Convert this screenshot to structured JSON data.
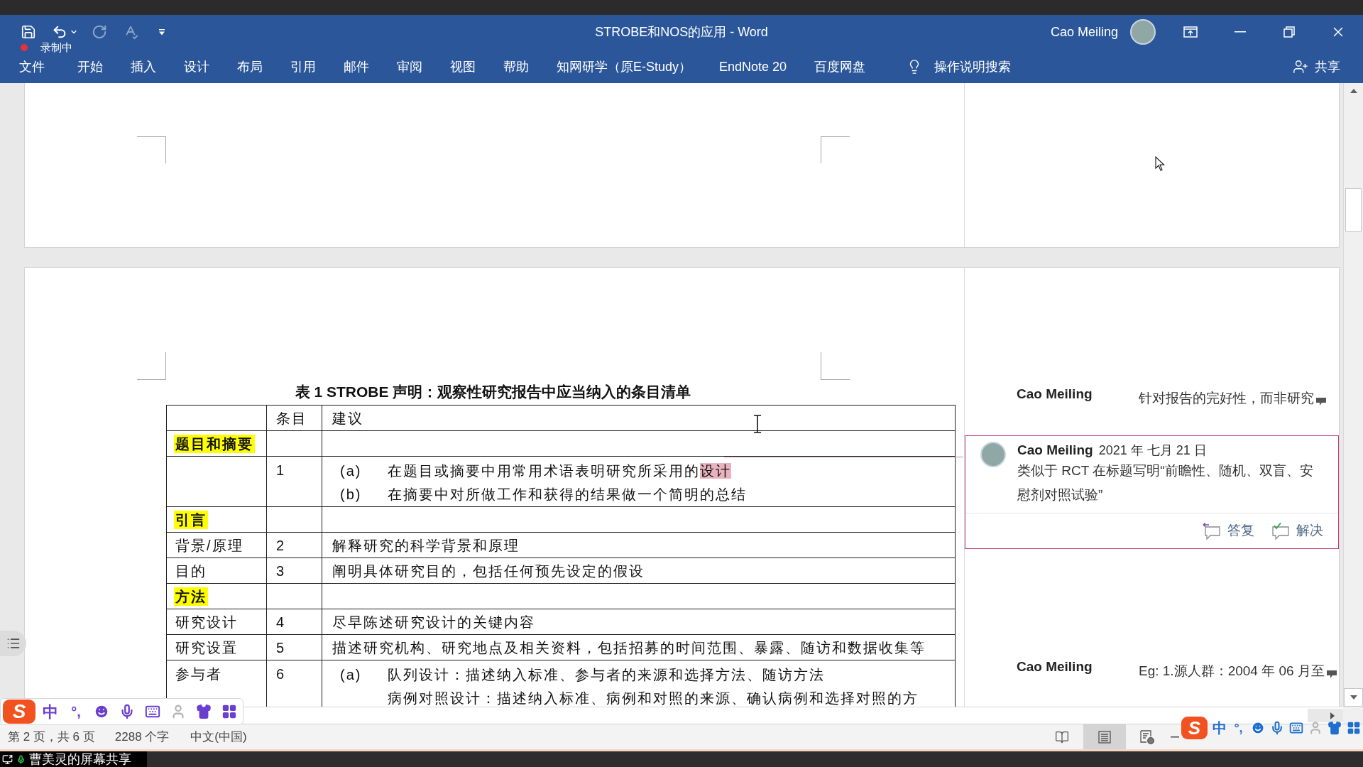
{
  "window": {
    "title": "STROBE和NOS的应用 - Word",
    "user": "Cao Meiling",
    "recording": "录制中"
  },
  "quick_access": [
    {
      "kind": "save",
      "disabled": false
    },
    {
      "kind": "undo",
      "disabled": false
    },
    {
      "kind": "redo",
      "disabled": true
    },
    {
      "kind": "spelling",
      "disabled": true
    },
    {
      "kind": "customize",
      "disabled": false
    }
  ],
  "ribbon_tabs": [
    "文件",
    "开始",
    "插入",
    "设计",
    "布局",
    "引用",
    "邮件",
    "审阅",
    "视图",
    "帮助",
    "知网研学（原E-Study）",
    "EndNote 20",
    "百度网盘"
  ],
  "tell_me": "操作说明搜索",
  "share": "共享",
  "table": {
    "title": "表 1 STROBE 声明：观察性研究报告中应当纳入的条目清单",
    "columns": [
      "条目",
      "建议"
    ],
    "rows": [
      {
        "kind": "section",
        "topic": "题目和摘要"
      },
      {
        "kind": "item",
        "number": "1",
        "entries": [
          {
            "marker": "(a)",
            "parts": [
              {
                "text": "在题目或摘要中用常用术语表明研究所采用的",
                "commented": false
              },
              {
                "text": "设计",
                "commented": true
              }
            ]
          },
          {
            "marker": "(b)",
            "parts": [
              {
                "text": "在摘要中对所做工作和获得的结果做一个简明的总结",
                "commented": false
              }
            ]
          }
        ]
      },
      {
        "kind": "section",
        "topic": "引言"
      },
      {
        "kind": "item",
        "topic": "背景/原理",
        "number": "2",
        "text": "解释研究的科学背景和原理"
      },
      {
        "kind": "item",
        "topic": "目的",
        "number": "3",
        "text": "阐明具体研究目的，包括任何预先设定的假设"
      },
      {
        "kind": "section",
        "topic": "方法"
      },
      {
        "kind": "item",
        "topic": "研究设计",
        "number": "4",
        "text": "尽早陈述研究设计的关键内容"
      },
      {
        "kind": "item",
        "topic": "研究设置",
        "number": "5",
        "text": "描述研究机构、研究地点及相关资料，包括招募的时间范围、暴露、随访和数据收集等"
      },
      {
        "kind": "item",
        "topic": "参与者",
        "number": "6",
        "entries": [
          {
            "marker": "(a)",
            "parts": [
              {
                "text": "队列设计：描述纳入标准、参与者的来源和选择方法、随访方法",
                "commented": false
              }
            ]
          },
          {
            "parts": [
              {
                "text": "病例对照设计：描述纳入标准、病例和对照的来源、确认病例和选择对照的方",
                "commented": false
              }
            ]
          }
        ]
      }
    ]
  },
  "comments": [
    {
      "author": "Cao Meiling",
      "text": "针对报告的完好性，而非研究",
      "selected": false
    },
    {
      "author": "Cao Meiling",
      "date": "2021 年 七月 21 日",
      "text": "类似于 RCT 在标题写明“前瞻性、随机、双盲、安慰剂对照试验”",
      "selected": true,
      "actions": [
        {
          "kind": "reply",
          "label": "答复"
        },
        {
          "kind": "resolve",
          "label": "解决"
        }
      ]
    },
    {
      "author": "Cao Meiling",
      "text": "Eg: 1.源人群：2004 年 06 月至",
      "selected": false
    }
  ],
  "status_bar": {
    "page": "第 2 页，共 6 页",
    "words": "2288 个字",
    "language": "中文(中国)",
    "views": [
      {
        "kind": "read",
        "selected": false
      },
      {
        "kind": "print",
        "selected": true
      },
      {
        "kind": "web",
        "selected": false
      }
    ]
  },
  "ime_bars": [
    {
      "logo": "S",
      "mode": "中",
      "punct": "°,",
      "color": "#6a3fd0"
    },
    {
      "logo": "S",
      "mode": "中",
      "punct": "°,",
      "color": "#1f6fd0"
    }
  ],
  "screen_share": "曹美灵的屏幕共享"
}
